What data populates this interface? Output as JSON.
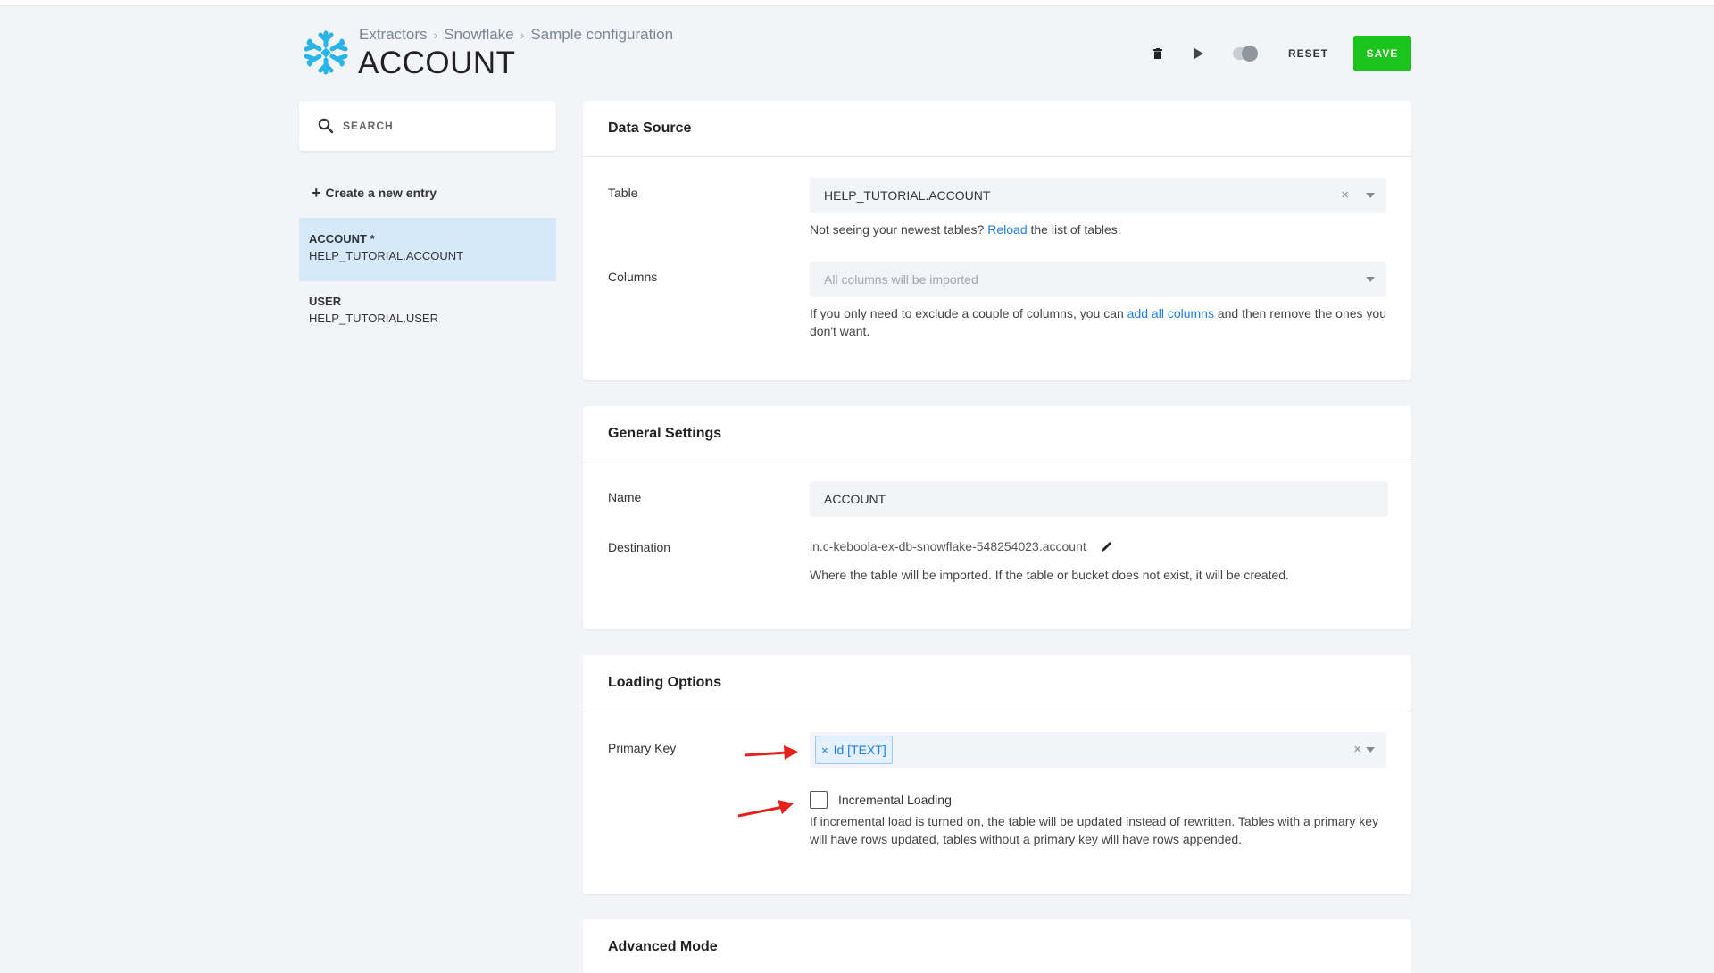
{
  "breadcrumb": [
    "Extractors",
    "Snowflake",
    "Sample configuration"
  ],
  "breadcrumb_separator": "›",
  "page_title": "ACCOUNT",
  "header_actions": {
    "reset_label": "RESET",
    "save_label": "SAVE"
  },
  "colors": {
    "accent": "#1ac41a",
    "link": "#1f7ee0",
    "logo": "#29b5e8",
    "active_entry_bg": "#d6e9fb",
    "annotation_arrow": "#e8201c"
  },
  "sidebar": {
    "search_placeholder": "SEARCH",
    "create_label": "Create a new entry",
    "entries": [
      {
        "title": "ACCOUNT *",
        "subtitle": "HELP_TUTORIAL.ACCOUNT",
        "active": true
      },
      {
        "title": "USER",
        "subtitle": "HELP_TUTORIAL.USER",
        "active": false
      }
    ]
  },
  "data_source": {
    "title": "Data Source",
    "table_label": "Table",
    "table_value": "HELP_TUTORIAL.ACCOUNT",
    "table_help_prefix": "Not seeing your newest tables?",
    "table_help_link": "Reload",
    "table_help_suffix": "the list of tables.",
    "columns_label": "Columns",
    "columns_placeholder": "All columns will be imported",
    "columns_help_prefix": "If you only need to exclude a couple of columns, you can",
    "columns_help_link": "add all columns",
    "columns_help_suffix": "and then remove the ones you don't want."
  },
  "general_settings": {
    "title": "General Settings",
    "name_label": "Name",
    "name_value": "ACCOUNT",
    "destination_label": "Destination",
    "destination_value": "in.c-keboola-ex-db-snowflake-548254023.account",
    "destination_help": "Where the table will be imported. If the table or bucket does not exist, it will be created."
  },
  "loading_options": {
    "title": "Loading Options",
    "primary_key_label": "Primary Key",
    "primary_key_tags": [
      "Id [TEXT]"
    ],
    "incremental_label": "Incremental Loading",
    "incremental_checked": false,
    "incremental_help": "If incremental load is turned on, the table will be updated instead of rewritten. Tables with a primary key will have rows updated, tables without a primary key will have rows appended."
  },
  "advanced_mode": {
    "title": "Advanced Mode"
  }
}
